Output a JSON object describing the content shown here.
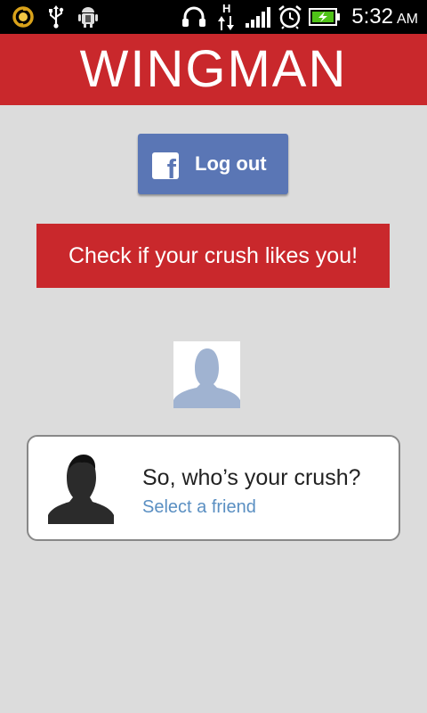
{
  "status_bar": {
    "time": "5:32",
    "ampm": "AM",
    "icons": [
      "sync-icon",
      "usb-icon",
      "android-debug-icon",
      "headphones-icon",
      "data-hspa-icon",
      "signal-icon",
      "alarm-icon",
      "battery-charging-icon"
    ]
  },
  "header": {
    "title": "WINGMAN"
  },
  "facebook": {
    "label": "Log out"
  },
  "cta": {
    "label": "Check if your crush likes you!"
  },
  "crush_card": {
    "title": "So, who’s your crush?",
    "link": "Select a friend"
  },
  "colors": {
    "brand_red": "#c9282c",
    "facebook_blue": "#5a76b5",
    "link_blue": "#5a8fc2",
    "background": "#dcdcdc"
  }
}
